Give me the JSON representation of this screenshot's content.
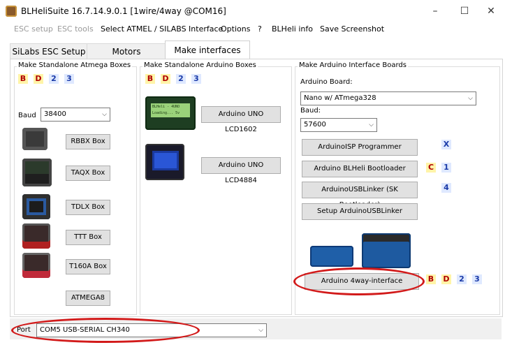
{
  "window": {
    "title": "BLHeliSuite 16.7.14.9.0.1  [1wire/4way @COM16]",
    "minimize_glyph": "–",
    "maximize_glyph": "☐",
    "close_glyph": "✕"
  },
  "menu": {
    "esc_setup": "ESC setup",
    "esc_tools": "ESC tools",
    "select_interface": "Select ATMEL / SILABS Interface",
    "options": "Options",
    "help": "?",
    "blheli_info": "BLHeli info",
    "save_screenshot": "Save Screenshot"
  },
  "tabs": [
    {
      "label": "SiLabs ESC Setup"
    },
    {
      "label": "Motors"
    },
    {
      "label": "Make interfaces"
    }
  ],
  "atmega_group": {
    "title": "Make Standalone Atmega Boxes",
    "badges": [
      "B",
      "D",
      "2",
      "3"
    ],
    "baud_label": "Baud",
    "baud_value": "38400",
    "buttons": [
      "RBBX Box",
      "TAQX Box",
      "TDLX Box",
      "TTT Box",
      "T160A Box",
      "ATMEGA8"
    ]
  },
  "arduino_boxes_group": {
    "title": "Make Standalone Arduino Boxes",
    "badges": [
      "B",
      "D",
      "2",
      "3"
    ],
    "buttons": [
      "Arduino UNO LCD1602",
      "Arduino UNO LCD4884"
    ],
    "lcd_line1": "BLHeli - 4UNO",
    "lcd_line2": "Loading...  5v"
  },
  "interface_group": {
    "title": "Make Arduino Interface Boards",
    "board_label": "Arduino Board:",
    "board_value": "Nano w/ ATmega328",
    "baud_label": "Baud:",
    "baud_value": "57600",
    "buttons": [
      "ArduinoISP Programmer",
      "Arduino BLHeli Bootloader",
      "ArduinoUSBLinker (SK Bootloader)",
      "Setup ArduinoUSBLinker",
      "Arduino 4way-interface"
    ],
    "isp_badge": "X",
    "bootloader_badges": [
      "C",
      "1"
    ],
    "usblinker_badge": "4",
    "fourway_badges": [
      "B",
      "D",
      "2",
      "3"
    ]
  },
  "statusbar": {
    "port_label": "Port",
    "port_value": "COM5   USB-SERIAL CH340"
  },
  "colors": {
    "highlight_ring": "#d21a1a",
    "badge_yellow": "#fff4a8",
    "badge_blue": "#dfe9ff"
  }
}
